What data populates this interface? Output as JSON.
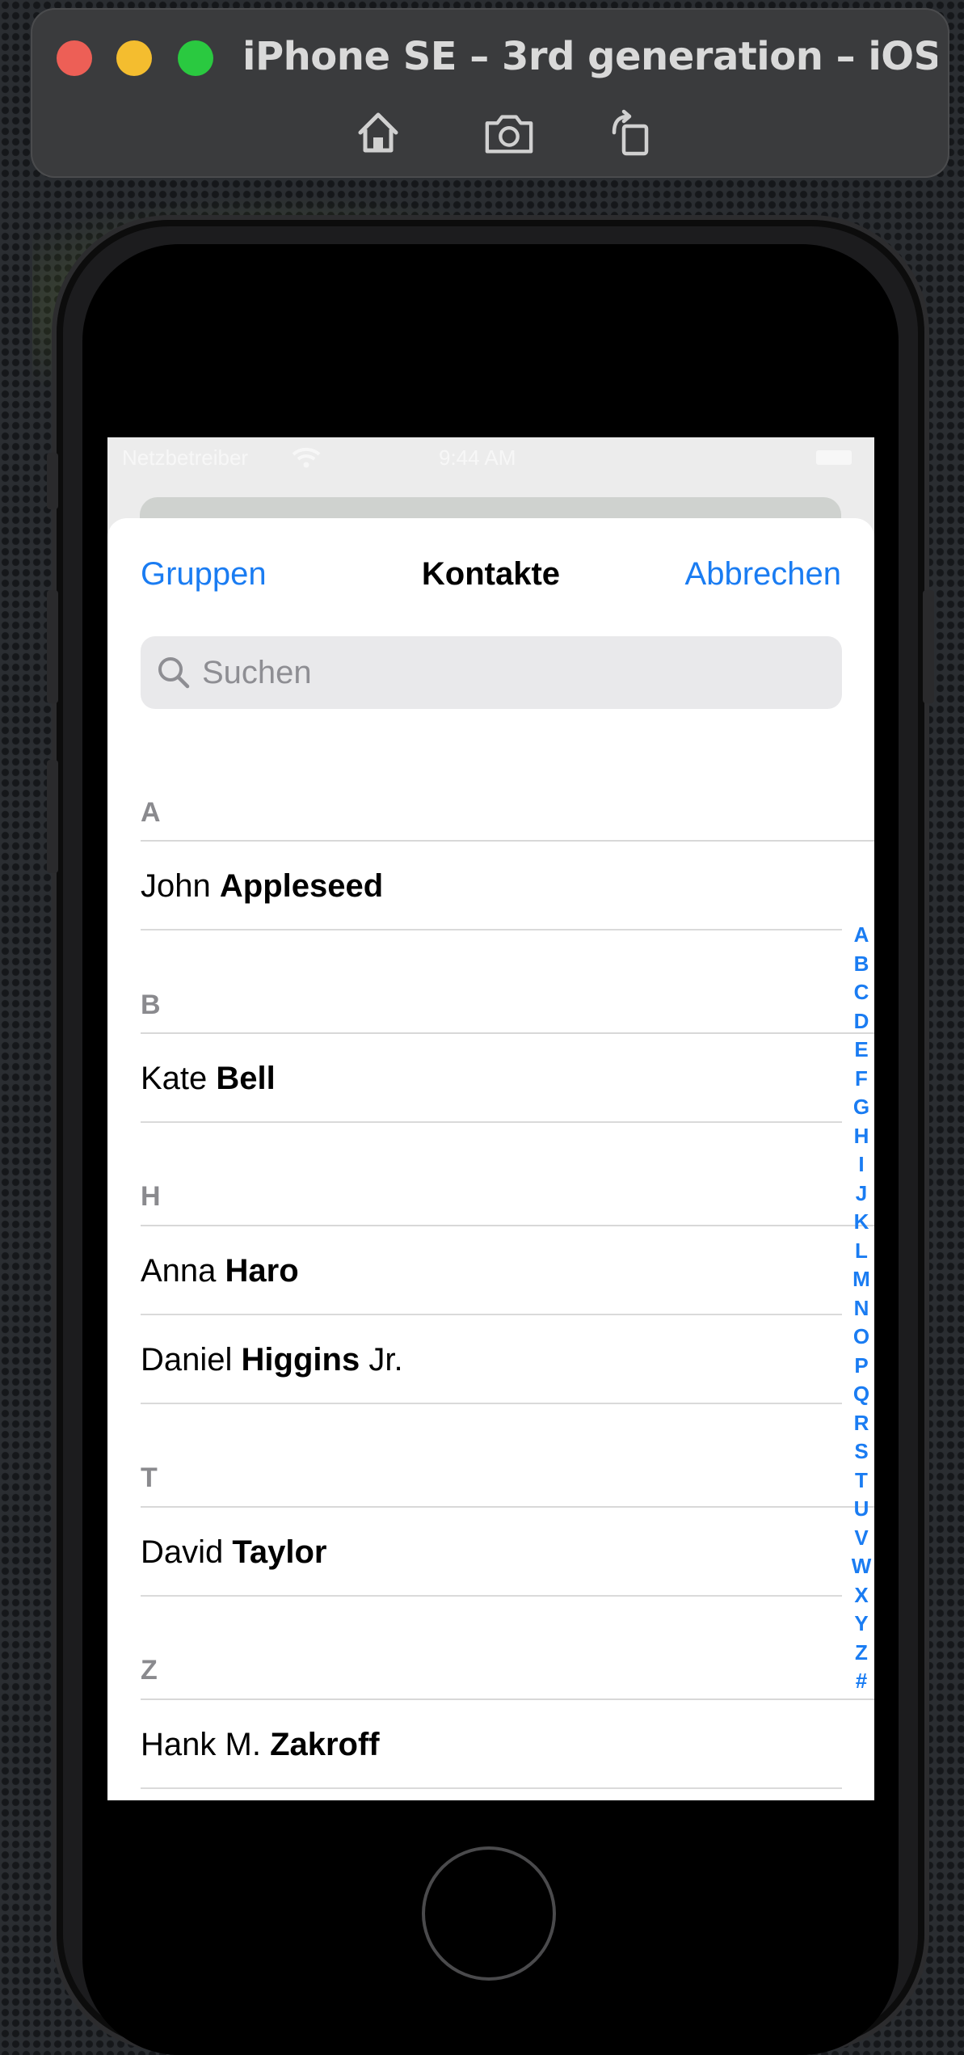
{
  "simulator": {
    "title": "iPhone SE – 3rd generation – iOS...",
    "toolbar": [
      "home-icon",
      "screenshot-icon",
      "rotate-icon"
    ]
  },
  "status_bar": {
    "carrier": "Netzbetreiber",
    "time": "9:44 AM"
  },
  "nav": {
    "left": "Gruppen",
    "title": "Kontakte",
    "right": "Abbrechen"
  },
  "search": {
    "placeholder": "Suchen"
  },
  "sections": [
    {
      "letter": "A",
      "contacts": [
        {
          "first": "John",
          "last": "Appleseed",
          "suffix": ""
        }
      ]
    },
    {
      "letter": "B",
      "contacts": [
        {
          "first": "Kate",
          "last": "Bell",
          "suffix": ""
        }
      ]
    },
    {
      "letter": "H",
      "contacts": [
        {
          "first": "Anna",
          "last": "Haro",
          "suffix": ""
        },
        {
          "first": "Daniel",
          "last": "Higgins",
          "suffix": "Jr."
        }
      ]
    },
    {
      "letter": "T",
      "contacts": [
        {
          "first": "David",
          "last": "Taylor",
          "suffix": ""
        }
      ]
    },
    {
      "letter": "Z",
      "contacts": [
        {
          "first": "Hank M.",
          "last": "Zakroff",
          "suffix": ""
        }
      ]
    }
  ],
  "index": [
    "A",
    "B",
    "C",
    "D",
    "E",
    "F",
    "G",
    "H",
    "I",
    "J",
    "K",
    "L",
    "M",
    "N",
    "O",
    "P",
    "Q",
    "R",
    "S",
    "T",
    "U",
    "V",
    "W",
    "X",
    "Y",
    "Z",
    "#"
  ],
  "colors": {
    "accent": "#1a7cf2",
    "header_text": "#8a8a8e"
  }
}
